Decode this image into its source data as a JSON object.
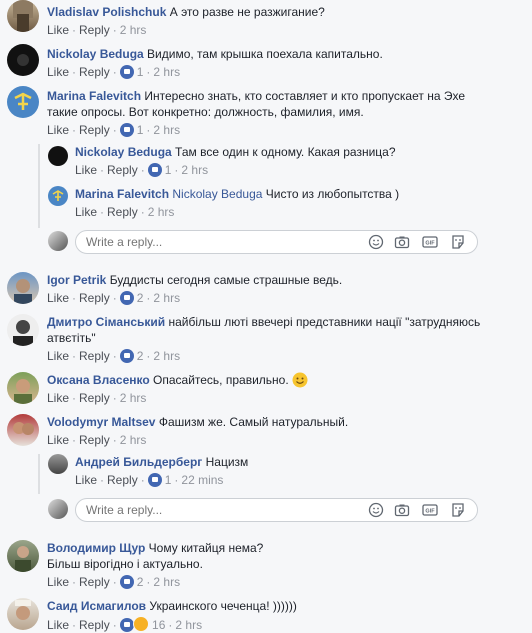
{
  "actions": {
    "like": "Like",
    "reply": "Reply",
    "separator": "·"
  },
  "reply_box": {
    "placeholder": "Write a reply..."
  },
  "comments": [
    {
      "name": "Vladislav Polishchuk",
      "text": "А это разве не разжигание?",
      "likes": "",
      "time": "2 hrs"
    },
    {
      "name": "Nickolay Beduga",
      "text": "Видимо, там крышка поехала капитально.",
      "likes": "1",
      "time": "2 hrs"
    },
    {
      "name": "Marina Falevitch",
      "text": "Интересно знать, кто составляет и кто пропускает на Эхе",
      "text2": "такие опросы. Вот конкретно: должность, фамилия, имя.",
      "likes": "1",
      "time": "2 hrs",
      "replies": [
        {
          "name": "Nickolay Beduga",
          "text": "Там все один к одному. Какая разница?",
          "likes": "1",
          "time": "2 hrs"
        },
        {
          "name": "Marina Falevitch",
          "mention": "Nickolay Beduga",
          "text": "Чисто из любопытства )",
          "likes": "",
          "time": "2 hrs"
        }
      ]
    },
    {
      "name": "Igor Petrik",
      "text": "Буддисты сегодня самые страшные ведь.",
      "likes": "2",
      "time": "2 hrs"
    },
    {
      "name": "Дмитро Сіманський",
      "text": "найбільш люті ввечері представники нації \"затрудняюсь",
      "text2": "атвєтіть\"",
      "likes": "2",
      "time": "2 hrs"
    },
    {
      "name": "Оксана Власенко",
      "text": "Опасайтесь, правильно.",
      "likes": "",
      "time": "2 hrs"
    },
    {
      "name": "Volodymyr Maltsev",
      "text": "Фашизм же. Самый натуральный.",
      "likes": "",
      "time": "2 hrs",
      "replies": [
        {
          "name": "Андрей Бильдерберг",
          "text": "Нацизм",
          "likes": "1",
          "time": "22 mins"
        }
      ]
    },
    {
      "name": "Володимир Щур",
      "text": "Чому китайця нема?",
      "text2": "Більш вірогідно і актуально.",
      "likes": "2",
      "time": "2 hrs"
    },
    {
      "name": "Саид Исмагилов",
      "text": "Украинского чеченца! ))))))",
      "likes": "16",
      "time": "2 hrs"
    }
  ],
  "colors": {
    "link": "#385898",
    "text": "#1d2129",
    "meta": "#90949c",
    "like_blue": "#4267b2",
    "background": "#f6f7f9"
  }
}
